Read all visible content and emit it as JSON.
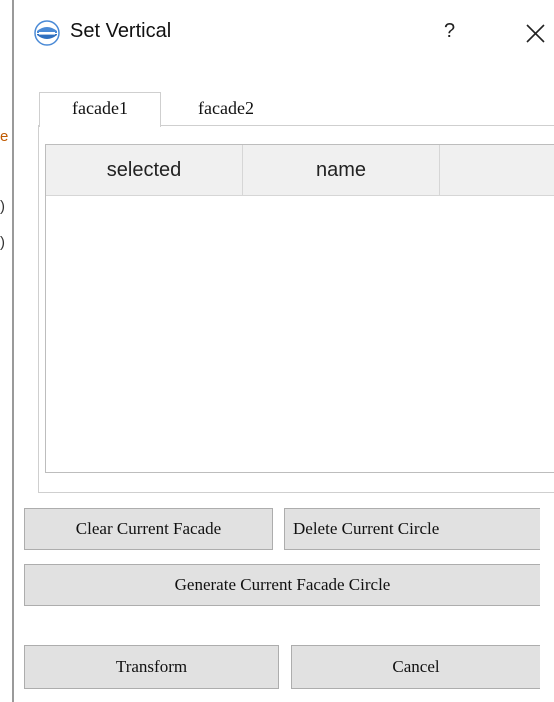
{
  "background_fragments": [
    "e",
    ")",
    ")"
  ],
  "window": {
    "title": "Set Vertical",
    "help_label": "?",
    "close_icon": "close-icon",
    "app_icon": "app-logo-icon"
  },
  "tabs": [
    {
      "label": "facade1",
      "active": true
    },
    {
      "label": "facade2",
      "active": false
    }
  ],
  "table": {
    "columns": [
      "selected",
      "name",
      ""
    ],
    "rows": []
  },
  "buttons": {
    "clear": "Clear Current Facade",
    "delete": "Delete Current Circle",
    "generate": "Generate Current Facade Circle",
    "transform": "Transform",
    "cancel": "Cancel"
  },
  "colors": {
    "button_bg": "#e1e1e1",
    "header_bg": "#f0f0f0",
    "border": "#adadad"
  }
}
